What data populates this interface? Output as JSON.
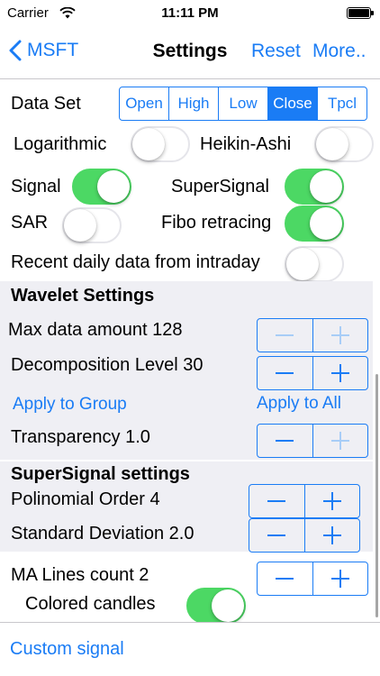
{
  "status_bar": {
    "carrier": "Carrier",
    "time": "11:11 PM"
  },
  "nav": {
    "back_label": "MSFT",
    "title": "Settings",
    "reset_label": "Reset",
    "more_label": "More.."
  },
  "data_set": {
    "label": "Data Set",
    "options": [
      "Open",
      "High",
      "Low",
      "Close",
      "Tpcl"
    ],
    "selected": "Close"
  },
  "toggles": {
    "logarithmic": {
      "label": "Logarithmic",
      "on": false
    },
    "heikin_ashi": {
      "label": "Heikin-Ashi",
      "on": false
    },
    "signal": {
      "label": "Signal",
      "on": true
    },
    "supersignal": {
      "label": "SuperSignal",
      "on": true
    },
    "sar": {
      "label": "SAR",
      "on": false
    },
    "fibo": {
      "label": "Fibo retracing",
      "on": true
    },
    "recent_daily": {
      "label": "Recent daily data from intraday",
      "on": false
    }
  },
  "wavelet": {
    "title": "Wavelet Settings",
    "max_data_label": "Max data amount 128",
    "decomposition_label": "Decomposition Level  30",
    "apply_group": "Apply to Group",
    "apply_all": "Apply to All",
    "transparency_label": "Transparency 1.0"
  },
  "supersignal_settings": {
    "title": "SuperSignal settings",
    "polinomial_label": "Polinomial Order   4",
    "std_dev_label": "Standard Deviation 2.0"
  },
  "ma": {
    "lines_label": "MA Lines count   2",
    "colored_candles_label": "Colored candles",
    "colored_candles_on": true
  },
  "bottom": {
    "custom_signal": "Custom signal"
  },
  "colors": {
    "accent": "#1a7cf5",
    "switch_on": "#4cd864",
    "section_bg": "#efeff4"
  }
}
